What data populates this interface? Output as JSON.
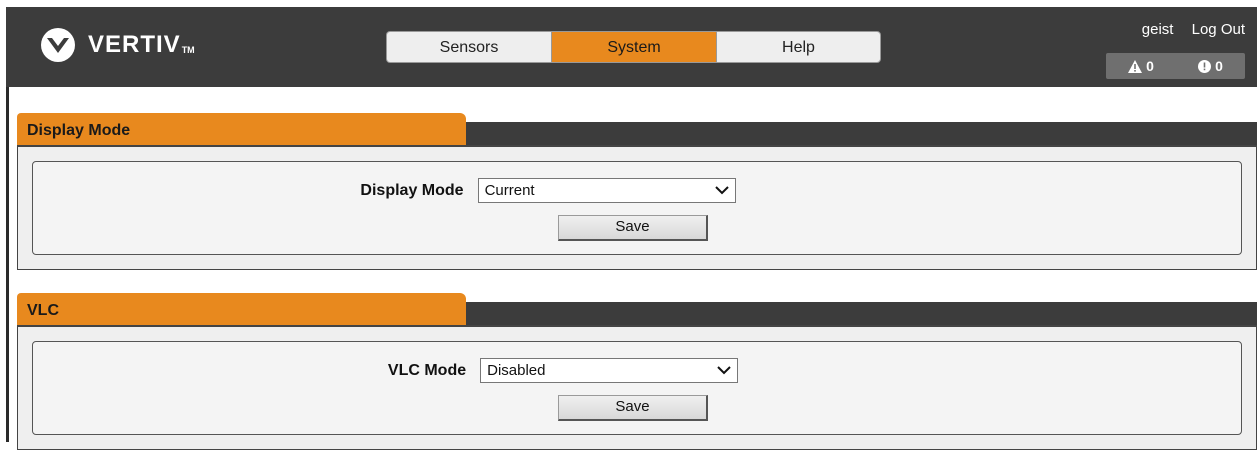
{
  "header": {
    "brand": "VERTIV",
    "brand_tm": "TM",
    "nav": [
      {
        "label": "Sensors",
        "active": false
      },
      {
        "label": "System",
        "active": true
      },
      {
        "label": "Help",
        "active": false
      }
    ],
    "user": "geist",
    "logout": "Log Out",
    "alarms": {
      "warning_count": "0",
      "critical_count": "0"
    },
    "colors": {
      "accent": "#e8891e",
      "header_bg": "#3c3c3c"
    }
  },
  "sections": {
    "display_mode": {
      "title": "Display Mode",
      "field_label": "Display Mode",
      "selected": "Current",
      "save_label": "Save"
    },
    "vlc": {
      "title": "VLC",
      "field_label": "VLC Mode",
      "selected": "Disabled",
      "save_label": "Save"
    }
  }
}
